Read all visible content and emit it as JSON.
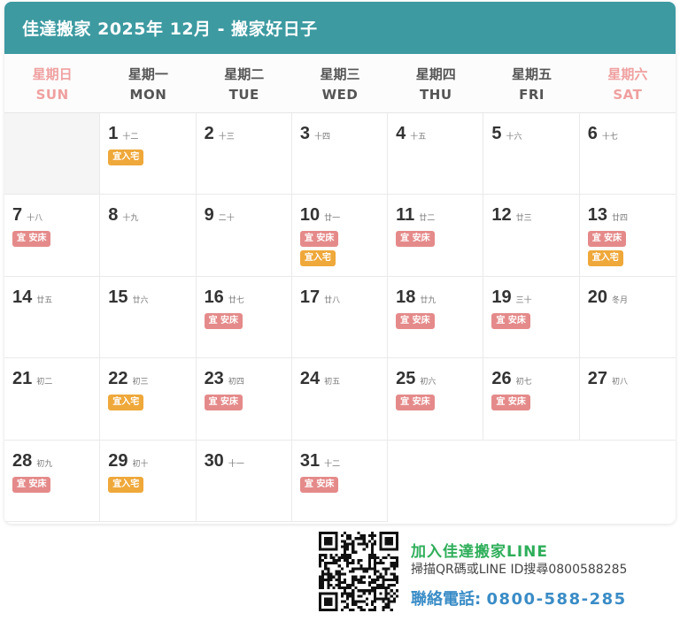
{
  "header": {
    "title": "佳達搬家 2025年 12月 - 搬家好日子"
  },
  "colors": {
    "header_bg": "#3d9aa1",
    "weekend": "#f0a0a0",
    "tag_bed": "#e58a8a",
    "tag_house": "#efa83a",
    "line_green": "#2eae5a",
    "phone_blue": "#3a8cc6"
  },
  "weekdays": [
    {
      "zh": "星期日",
      "en": "SUN"
    },
    {
      "zh": "星期一",
      "en": "MON"
    },
    {
      "zh": "星期二",
      "en": "TUE"
    },
    {
      "zh": "星期三",
      "en": "WED"
    },
    {
      "zh": "星期四",
      "en": "THU"
    },
    {
      "zh": "星期五",
      "en": "FRI"
    },
    {
      "zh": "星期六",
      "en": "SAT"
    }
  ],
  "tag_labels": {
    "bed": "宜 安床",
    "house": "宜入宅"
  },
  "days": [
    {
      "day": "1",
      "lunar": "十二",
      "tags": [
        "house"
      ]
    },
    {
      "day": "2",
      "lunar": "十三",
      "tags": []
    },
    {
      "day": "3",
      "lunar": "十四",
      "tags": []
    },
    {
      "day": "4",
      "lunar": "十五",
      "tags": []
    },
    {
      "day": "5",
      "lunar": "十六",
      "tags": []
    },
    {
      "day": "6",
      "lunar": "十七",
      "tags": []
    },
    {
      "day": "7",
      "lunar": "十八",
      "tags": [
        "bed"
      ]
    },
    {
      "day": "8",
      "lunar": "十九",
      "tags": []
    },
    {
      "day": "9",
      "lunar": "二十",
      "tags": []
    },
    {
      "day": "10",
      "lunar": "廿一",
      "tags": [
        "bed",
        "house"
      ]
    },
    {
      "day": "11",
      "lunar": "廿二",
      "tags": [
        "bed"
      ]
    },
    {
      "day": "12",
      "lunar": "廿三",
      "tags": []
    },
    {
      "day": "13",
      "lunar": "廿四",
      "tags": [
        "bed",
        "house"
      ]
    },
    {
      "day": "14",
      "lunar": "廿五",
      "tags": []
    },
    {
      "day": "15",
      "lunar": "廿六",
      "tags": []
    },
    {
      "day": "16",
      "lunar": "廿七",
      "tags": [
        "bed"
      ]
    },
    {
      "day": "17",
      "lunar": "廿八",
      "tags": []
    },
    {
      "day": "18",
      "lunar": "廿九",
      "tags": [
        "bed"
      ]
    },
    {
      "day": "19",
      "lunar": "三十",
      "tags": [
        "bed"
      ]
    },
    {
      "day": "20",
      "lunar": "冬月",
      "tags": []
    },
    {
      "day": "21",
      "lunar": "初二",
      "tags": []
    },
    {
      "day": "22",
      "lunar": "初三",
      "tags": [
        "house"
      ]
    },
    {
      "day": "23",
      "lunar": "初四",
      "tags": [
        "bed"
      ]
    },
    {
      "day": "24",
      "lunar": "初五",
      "tags": []
    },
    {
      "day": "25",
      "lunar": "初六",
      "tags": [
        "bed"
      ]
    },
    {
      "day": "26",
      "lunar": "初七",
      "tags": [
        "bed"
      ]
    },
    {
      "day": "27",
      "lunar": "初八",
      "tags": []
    },
    {
      "day": "28",
      "lunar": "初九",
      "tags": [
        "bed"
      ]
    },
    {
      "day": "29",
      "lunar": "初十",
      "tags": [
        "house"
      ]
    },
    {
      "day": "30",
      "lunar": "十一",
      "tags": []
    },
    {
      "day": "31",
      "lunar": "十二",
      "tags": [
        "bed"
      ]
    }
  ],
  "promo": {
    "title": "加入佳達搬家LINE",
    "subtitle": "掃描QR碼或LINE ID搜尋0800588285",
    "phone_label": "聯絡電話: ",
    "phone": "0800-588-285"
  }
}
